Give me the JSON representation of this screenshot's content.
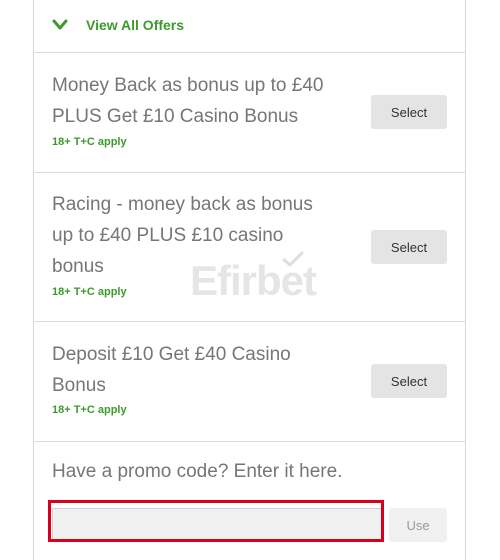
{
  "header": {
    "view_all_label": "View All Offers",
    "icon": "chevron-down-icon"
  },
  "offers": [
    {
      "title_lines": [
        "Money Back as bonus up to £40",
        "PLUS Get £10 Casino Bonus"
      ],
      "tc": "18+ T+C apply",
      "button": "Select"
    },
    {
      "title_lines": [
        "Racing - money back as bonus",
        "up to £40 PLUS £10 casino",
        "bonus"
      ],
      "tc": "18+ T+C apply",
      "button": "Select"
    },
    {
      "title_lines": [
        "Deposit £10 Get £40 Casino",
        "Bonus"
      ],
      "tc": "18+ T+C apply",
      "button": "Select"
    }
  ],
  "promo": {
    "label": "Have a promo code? Enter it here.",
    "input_value": "",
    "button": "Use"
  },
  "watermark": {
    "text": "Efirbet"
  },
  "colors": {
    "accent_green": "#3d9a2b",
    "highlight_red": "#d8001c",
    "button_gray": "#e4e4e4"
  }
}
